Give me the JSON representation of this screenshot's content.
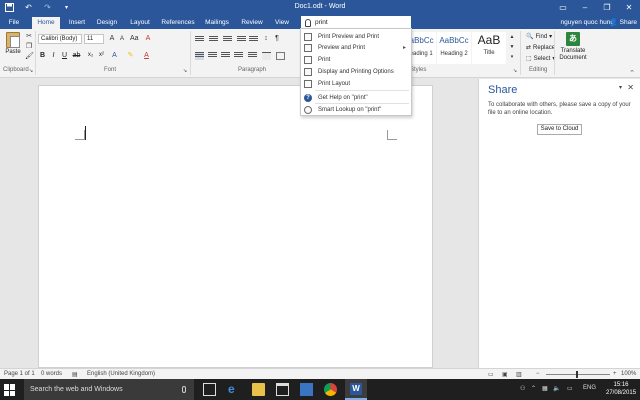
{
  "window": {
    "title": "Doc1.odt - Word",
    "qat": [
      "save-icon",
      "undo-icon",
      "redo-icon"
    ],
    "controls": [
      "ribbon-display-icon",
      "minimize-icon",
      "restore-icon",
      "close-icon"
    ]
  },
  "tabs": [
    "File",
    "Home",
    "Insert",
    "Design",
    "Layout",
    "References",
    "Mailings",
    "Review",
    "View"
  ],
  "active_tab": "Home",
  "tell_me": {
    "value": "print"
  },
  "user": {
    "name": "nguyen quoc hung",
    "share_label": "Share"
  },
  "ribbon": {
    "clipboard": {
      "label": "Clipboard",
      "paste": "Paste"
    },
    "font": {
      "label": "Font",
      "family": "Calibri (Body)",
      "size": "11"
    },
    "paragraph": {
      "label": "Paragraph"
    },
    "styles": {
      "label": "Styles",
      "tiles": [
        {
          "sample": "AaBbCc",
          "name": "Heading 1"
        },
        {
          "sample": "AaBbCc",
          "name": "Heading 2"
        },
        {
          "sample": "AaB",
          "name": "Title"
        }
      ]
    },
    "editing": {
      "label": "Editing",
      "find": "Find",
      "replace": "Replace",
      "select": "Select"
    },
    "translate": {
      "line1": "Translate",
      "line2": "Document"
    }
  },
  "dropdown": {
    "items": [
      {
        "label": "Print Preview and Print"
      },
      {
        "label": "Preview and Print"
      },
      {
        "label": "Print"
      },
      {
        "label": "Display and Printing Options"
      },
      {
        "label": "Print Layout"
      }
    ],
    "help": [
      {
        "label": "Get Help on \"print\""
      },
      {
        "label": "Smart Lookup on \"print\""
      }
    ]
  },
  "share_pane": {
    "title": "Share",
    "message": "To collaborate with others, please save a copy of your file to an online location.",
    "button": "Save to Cloud"
  },
  "status": {
    "page": "Page 1 of 1",
    "words": "0 words",
    "language": "English (United Kingdom)",
    "zoom": "100%"
  },
  "taskbar": {
    "search_placeholder": "Search the web and Windows",
    "lang": "ENG",
    "time": "15:16",
    "date": "27/08/2015"
  },
  "colors": {
    "accent": "#2b579a",
    "taskbar": "#1f1f1f"
  }
}
